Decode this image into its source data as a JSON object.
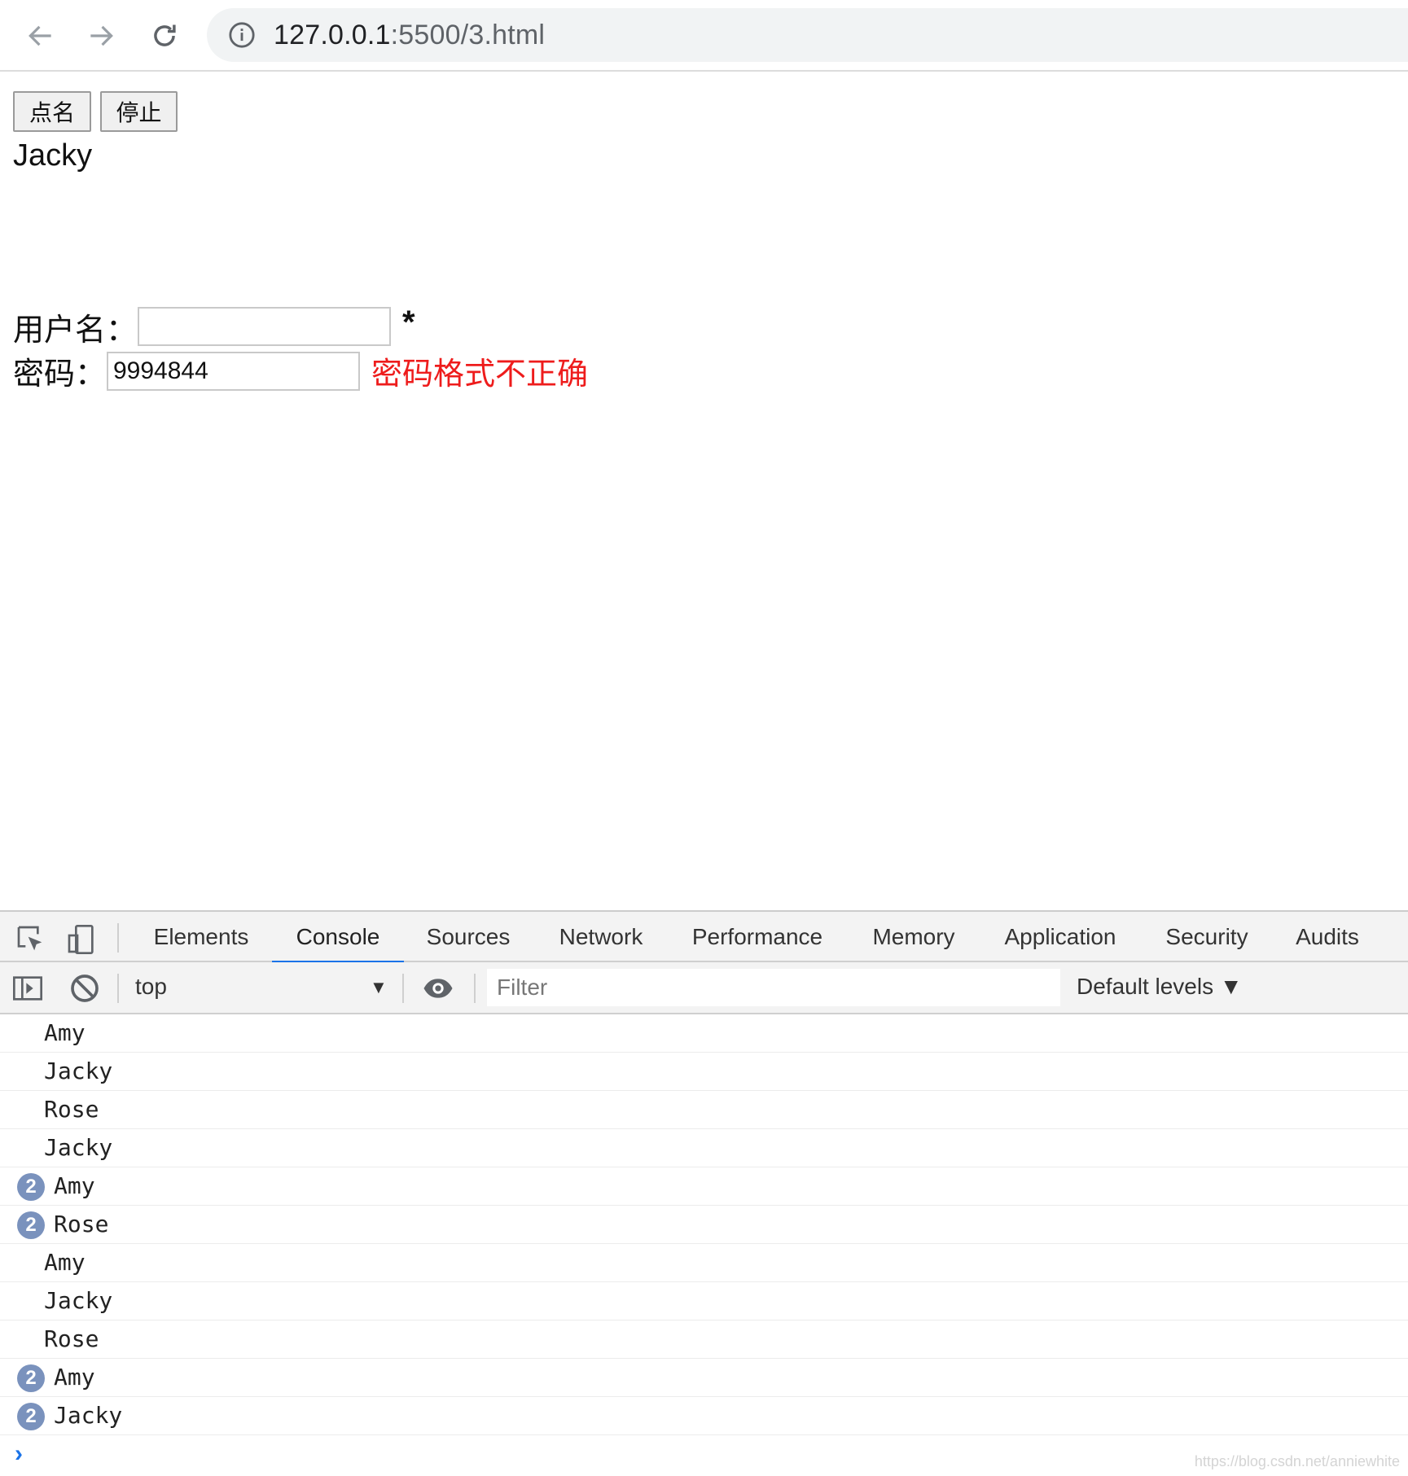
{
  "browser": {
    "url_host": "127.0.0.1",
    "url_path": ":5500/3.html"
  },
  "page": {
    "call_button_label": "点名",
    "stop_button_label": "停止",
    "current_name": "Jacky",
    "username_label": "用户名：",
    "username_value": "",
    "required_mark": "*",
    "password_label": "密码：",
    "password_value": "9994844",
    "password_error": "密码格式不正确"
  },
  "devtools": {
    "tabs": [
      {
        "label": "Elements"
      },
      {
        "label": "Console",
        "active": true
      },
      {
        "label": "Sources"
      },
      {
        "label": "Network"
      },
      {
        "label": "Performance"
      },
      {
        "label": "Memory"
      },
      {
        "label": "Application"
      },
      {
        "label": "Security"
      },
      {
        "label": "Audits"
      }
    ],
    "context": "top",
    "filter_placeholder": "Filter",
    "levels_label": "Default levels ▼",
    "console_rows": [
      {
        "text": "Amy",
        "count": ""
      },
      {
        "text": "Jacky",
        "count": ""
      },
      {
        "text": "Rose",
        "count": ""
      },
      {
        "text": "Jacky",
        "count": ""
      },
      {
        "text": "Amy",
        "count": "2"
      },
      {
        "text": "Rose",
        "count": "2"
      },
      {
        "text": "Amy",
        "count": ""
      },
      {
        "text": "Jacky",
        "count": ""
      },
      {
        "text": "Rose",
        "count": ""
      },
      {
        "text": "Amy",
        "count": "2"
      },
      {
        "text": "Jacky",
        "count": "2"
      }
    ],
    "prompt_symbol": "›"
  },
  "watermark": "https://blog.csdn.net/anniewhite",
  "colors": {
    "error_red": "#ee1c1c",
    "active_tab_blue": "#1a73e8",
    "count_badge": "#7a92bd"
  }
}
